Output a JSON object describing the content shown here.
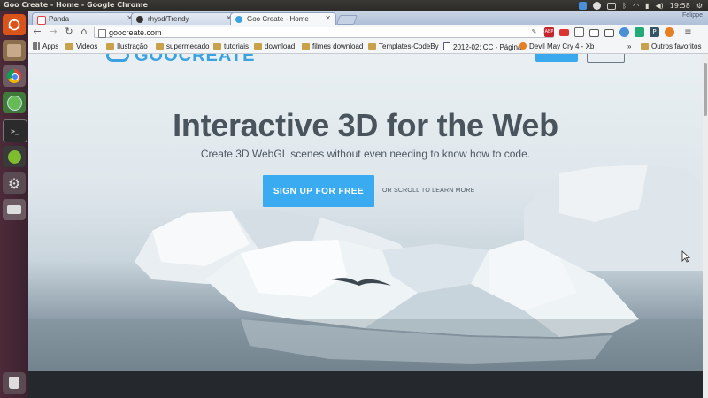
{
  "os": {
    "window_title": "Goo Create - Home - Google Chrome",
    "clock": "19:58",
    "user_button": "Felippe"
  },
  "browser": {
    "tabs": [
      {
        "label": "Panda",
        "icon": "gmail-icon",
        "active": false
      },
      {
        "label": "rhysd/Trendy",
        "icon": "github-icon",
        "active": false
      },
      {
        "label": "Goo Create - Home",
        "icon": "goo-icon",
        "active": true
      }
    ],
    "url": "goocreate.com",
    "extensions": [
      {
        "name": "dropper-icon",
        "color": "#7a7a7a"
      },
      {
        "name": "abp-icon",
        "label": "ABP",
        "color": "#c8232b"
      },
      {
        "name": "flag-icon",
        "color": "#d33"
      },
      {
        "name": "hangouts-icon",
        "color": "#666"
      },
      {
        "name": "cast-icon",
        "color": "#555"
      },
      {
        "name": "cloud-icon",
        "color": "#4a90d9"
      },
      {
        "name": "keep-icon",
        "color": "#2a7"
      },
      {
        "name": "p-icon",
        "label": "P",
        "color": "#356"
      },
      {
        "name": "fox-icon",
        "color": "#e67e22"
      },
      {
        "name": "menu-icon",
        "color": "#666"
      }
    ],
    "bookmarks": [
      {
        "label": "Apps",
        "type": "apps"
      },
      {
        "label": "Videos",
        "type": "folder"
      },
      {
        "label": "Ilustração",
        "type": "folder"
      },
      {
        "label": "supermecado",
        "type": "folder"
      },
      {
        "label": "tutoriais",
        "type": "folder"
      },
      {
        "label": "download",
        "type": "folder"
      },
      {
        "label": "filmes download",
        "type": "folder"
      },
      {
        "label": "Templates-CodeBy",
        "type": "folder"
      },
      {
        "label": "2012-02: CC - Página",
        "type": "page"
      },
      {
        "label": "Devil May Cry 4 - Xb",
        "type": "page"
      },
      {
        "label": "Outros favoritos",
        "type": "folder"
      }
    ],
    "bookmarks_overflow": "»"
  },
  "page": {
    "logo": "GOOCREATE",
    "headline": "Interactive 3D for the Web",
    "subheadline": "Create 3D WebGL scenes without even needing to know how to code.",
    "cta_button": "SIGN UP FOR FREE",
    "scroll_link": "OR SCROLL TO LEARN MORE"
  },
  "colors": {
    "accent": "#3aabf0",
    "headline": "#4a545d",
    "launcher": "#4e2a38"
  }
}
